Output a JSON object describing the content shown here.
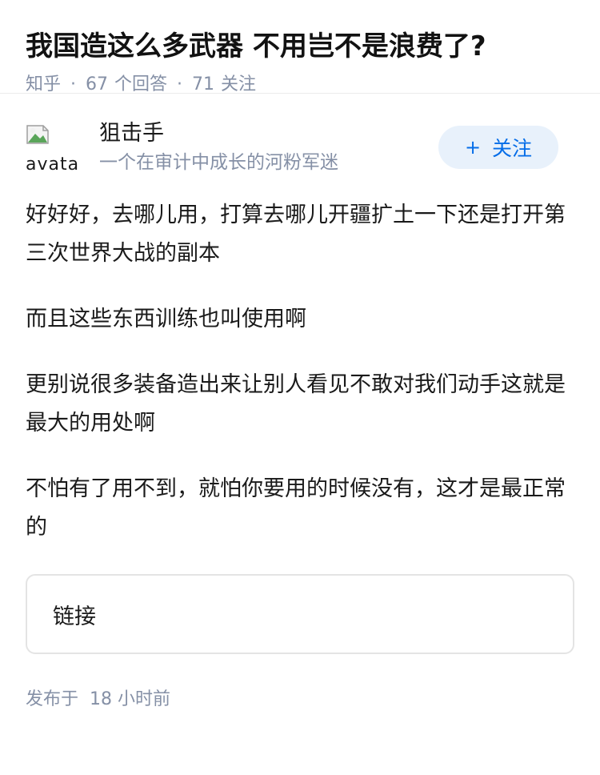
{
  "question": {
    "title": "我国造这么多武器 不用岂不是浪费了?",
    "site": "知乎",
    "separator": "·",
    "answer_count": "67",
    "answer_label": "个回答",
    "follower_count": "71",
    "follower_label": "关注"
  },
  "author": {
    "avatar_alt": "avatar",
    "name": "狙击手",
    "bio": "一个在审计中成长的河粉军迷",
    "follow_button": {
      "icon": "plus-icon",
      "plus": "+",
      "label": "关注"
    }
  },
  "answer": {
    "paragraphs": [
      "好好好，去哪儿用，打算去哪儿开疆扩土一下还是打开第三次世界大战的副本",
      "而且这些东西训练也叫使用啊",
      "更别说很多装备造出来让别人看见不敢对我们动手这就是最大的用处啊",
      "不怕有了用不到，就怕你要用的时候没有，这才是最正常的"
    ],
    "link_card_label": "链接",
    "published_label": "发布于",
    "published_time": "18 小时前"
  },
  "colors": {
    "meta_gray": "#8590a6",
    "follow_blue": "#056de8",
    "follow_bg": "#e8f1fb"
  }
}
